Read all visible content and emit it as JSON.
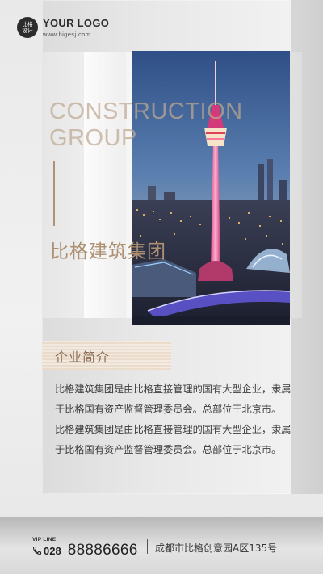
{
  "logo": {
    "badge_line1": "比格",
    "badge_line2": "设计",
    "title": "YOUR LOGO",
    "url": "www.bigesj.com"
  },
  "hero": {
    "headline_en_line1": "CONSTRUCTION",
    "headline_en_line2": "GROUP",
    "headline_cn": "比格建筑集团",
    "photo_subject": "illuminated TV tower over city skyline at dusk"
  },
  "intro": {
    "title": "企业简介",
    "paragraphs": [
      "比格建筑集团是由比格直接管理的国有大型企业，隶属于比格国有资产监督管理委员会。总部位于北京市。",
      "比格建筑集团是由比格直接管理的国有大型企业，隶属于比格国有资产监督管理委员会。总部位于北京市。"
    ]
  },
  "footer": {
    "vip_label": "VIP LINE",
    "area_code": "028",
    "phone": "88886666",
    "address": "成都市比格创意园A区135号",
    "icon": "phone-icon"
  },
  "colors": {
    "accent": "#ad8f72",
    "background": "#ececec",
    "text": "#3c3c3c"
  }
}
